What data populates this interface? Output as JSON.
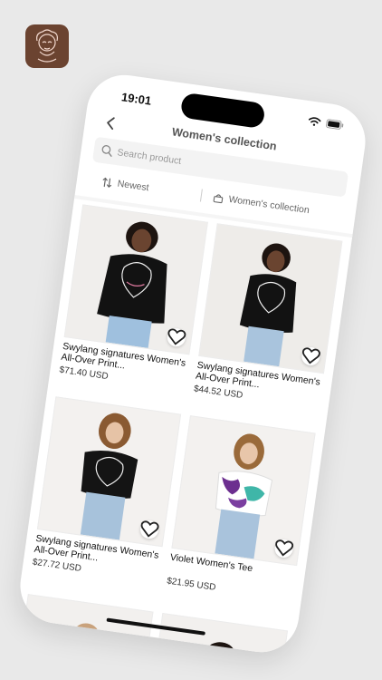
{
  "status": {
    "time": "19:01"
  },
  "nav": {
    "title": "Women's collection"
  },
  "search": {
    "placeholder": "Search product"
  },
  "filters": {
    "sort_label": "Newest",
    "category_label": "Women's collection"
  },
  "products": [
    {
      "name": "Swylang signatures Women's All-Over Print...",
      "price": "$71.40 USD"
    },
    {
      "name": "Swylang signatures Women's All-Over Print...",
      "price": "$44.52 USD"
    },
    {
      "name": "Swylang signatures Women's All-Over Print...",
      "price": "$27.72 USD"
    },
    {
      "name": "Violet Women's Tee",
      "price": "$21.95 USD"
    }
  ],
  "icons": {
    "back": "chevron-left-icon",
    "search": "search-icon",
    "sort": "sort-arrows-icon",
    "category": "bag-icon",
    "favorite": "heart-icon"
  }
}
